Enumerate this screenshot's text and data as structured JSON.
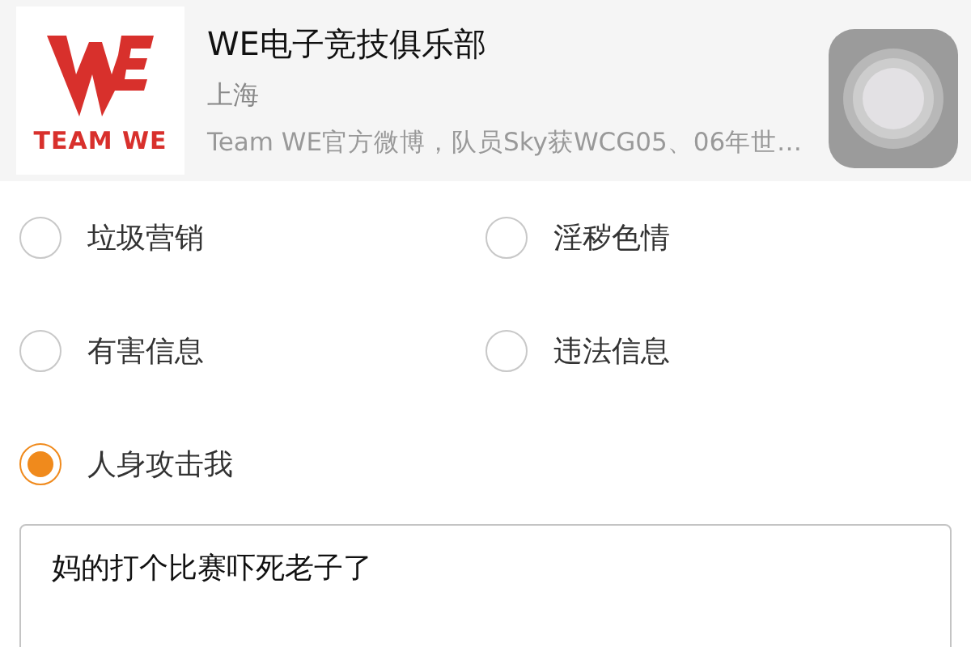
{
  "account": {
    "logo_text": "TEAM WE",
    "name": "WE电子竞技俱乐部",
    "location": "上海",
    "description": "Team WE官方微博，队员Sky获WCG05、06年世…"
  },
  "reasons": [
    {
      "label": "垃圾营销",
      "selected": false
    },
    {
      "label": "淫秽色情",
      "selected": false
    },
    {
      "label": "有害信息",
      "selected": false
    },
    {
      "label": "违法信息",
      "selected": false
    },
    {
      "label": "人身攻击我",
      "selected": true
    }
  ],
  "comment": {
    "value": "妈的打个比赛吓死老子了"
  }
}
